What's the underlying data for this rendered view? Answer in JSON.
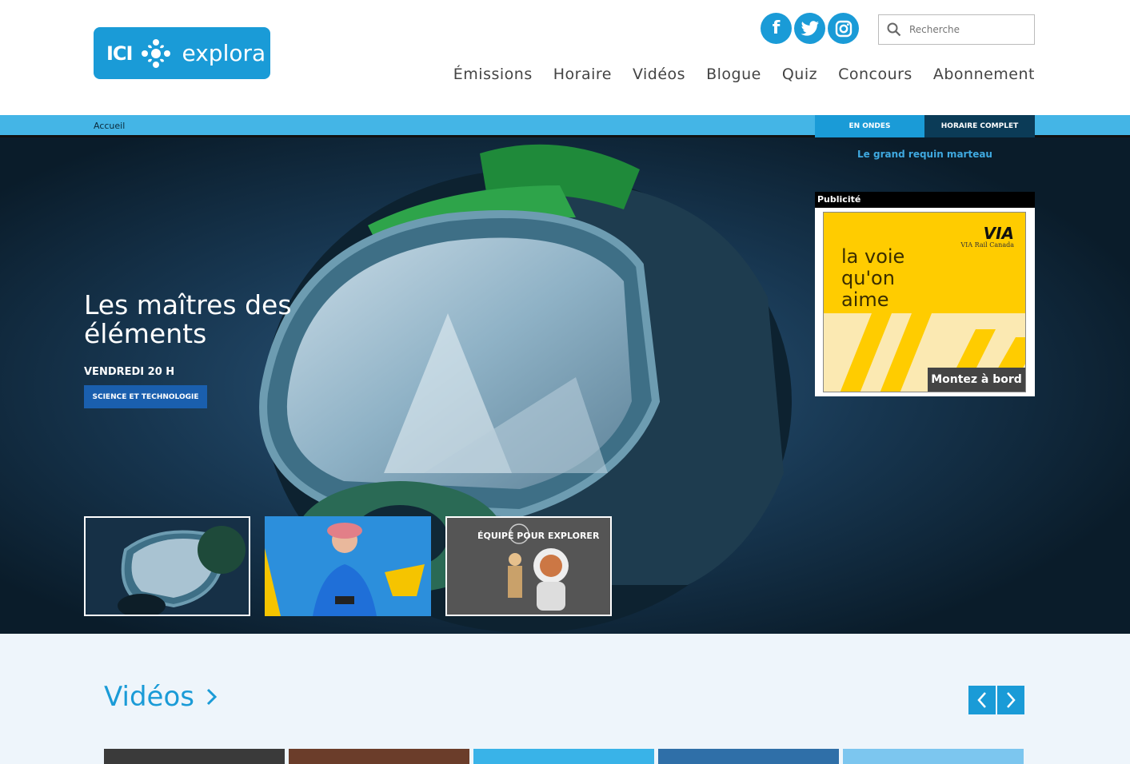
{
  "header": {
    "logo": {
      "prefix": "ICI",
      "name": "explora"
    },
    "social": [
      "facebook-icon",
      "twitter-icon",
      "instagram-icon"
    ],
    "social_glyphs": [
      "f",
      "t",
      "◎"
    ],
    "search": {
      "placeholder": "Recherche"
    },
    "nav": [
      "Émissions",
      "Horaire",
      "Vidéos",
      "Blogue",
      "Quiz",
      "Concours",
      "Abonnement"
    ]
  },
  "subbar": {
    "breadcrumb": "Accueil",
    "tab_on_air": "EN ONDES",
    "tab_schedule": "HORAIRE COMPLET",
    "now_playing": "Le grand requin marteau"
  },
  "hero": {
    "title": "Les maîtres des éléments",
    "time": "VENDREDI 20 H",
    "category": "SCIENCE ET TECHNOLOGIE",
    "thumb3_label": "ÉQUIPÉ      POUR EXPLORER"
  },
  "ad": {
    "label": "Publicité",
    "brand": "VIA",
    "brand_sub": "VIA Rail Canada",
    "slogan": "la voie qu'on aime",
    "cta": "Montez à bord"
  },
  "videos": {
    "title": "Vidéos"
  },
  "colors": {
    "accent": "#1a9bd7",
    "bar": "#44b5e6",
    "dark_tab": "#0b3b57",
    "ad_yellow": "#ffcc00"
  }
}
